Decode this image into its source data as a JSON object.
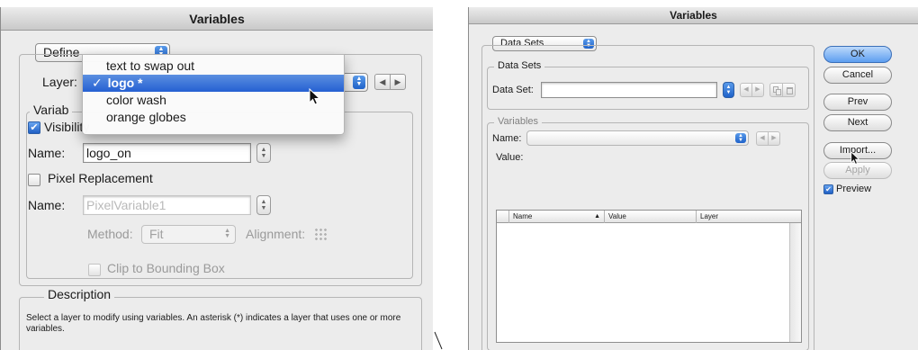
{
  "left_window": {
    "title": "Variables",
    "define_popup": "Define",
    "layer_label": "Layer:",
    "layer_menu": {
      "items": [
        "text to swap out",
        "logo *",
        "color wash",
        "orange globes"
      ],
      "selected_index": 1,
      "check_glyph": "✓"
    },
    "variables_legend": "Variab",
    "visibility": {
      "label": "Visibility",
      "checked": true
    },
    "name_label": "Name:",
    "visibility_name_value": "logo_on",
    "pixel_replacement": {
      "label": "Pixel Replacement",
      "checked": false
    },
    "pixel_name_label": "Name:",
    "pixel_name_value": "PixelVariable1",
    "method_label": "Method:",
    "method_value": "Fit",
    "alignment_label": "Alignment:",
    "clip_label": "Clip to Bounding Box",
    "description_legend": "Description",
    "description_text": "Select a layer to modify using variables. An asterisk (*) indicates a layer that uses one or more variables."
  },
  "right_window": {
    "title": "Variables",
    "top_popup": "Data Sets",
    "data_sets_legend": "Data Sets",
    "data_set_label": "Data Set:",
    "data_set_value": "",
    "variables_legend": "Variables",
    "name_label": "Name:",
    "name_value": "",
    "value_label": "Value:",
    "table_columns": [
      "Name",
      "Value",
      "Layer"
    ],
    "sort_glyph": "▲",
    "buttons": {
      "ok": "OK",
      "cancel": "Cancel",
      "prev": "Prev",
      "next": "Next",
      "import": "Import...",
      "apply": "Apply"
    },
    "preview": {
      "label": "Preview",
      "checked": true
    }
  },
  "colors": {
    "window_bg": "#ececec",
    "selection_blue": "#2560d2",
    "default_button": "#5d9ef0"
  },
  "icons": [
    "up-down-arrows-icon",
    "left-arrow-icon",
    "right-arrow-icon",
    "checkmark-icon",
    "mouse-cursor-icon",
    "alignment-grid-icon",
    "duplicate-icon",
    "trash-icon"
  ]
}
